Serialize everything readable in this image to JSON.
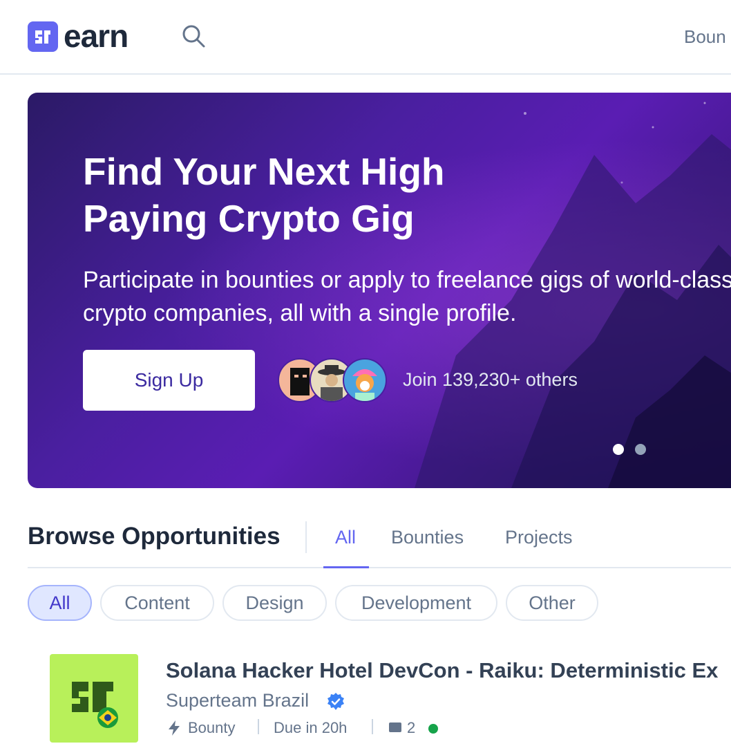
{
  "header": {
    "logo_text": "earn",
    "nav_link": "Boun"
  },
  "hero": {
    "title": "Find Your Next High Paying Crypto Gig",
    "subtitle": "Participate in bounties or apply to freelance gigs of world-class crypto companies, all with a single profile.",
    "signup_label": "Sign Up",
    "join_text": "Join 139,230+ others",
    "carousel_dots": 2,
    "carousel_active_index": 0
  },
  "browse": {
    "title": "Browse Opportunities",
    "tabs": [
      {
        "label": "All",
        "active": true
      },
      {
        "label": "Bounties",
        "active": false
      },
      {
        "label": "Projects",
        "active": false
      }
    ],
    "chips": [
      {
        "label": "All",
        "active": true
      },
      {
        "label": "Content",
        "active": false
      },
      {
        "label": "Design",
        "active": false
      },
      {
        "label": "Development",
        "active": false
      },
      {
        "label": "Other",
        "active": false
      }
    ]
  },
  "listing": {
    "title": "Solana Hacker Hotel DevCon - Raiku: Deterministic Ex",
    "sponsor": "Superteam Brazil",
    "type": "Bounty",
    "due": "Due in 20h",
    "comments": "2"
  },
  "colors": {
    "accent": "#6366f1",
    "hero_bg": "#4a1fa0",
    "listing_logo_bg": "#b8f05a",
    "status_green": "#16a34a"
  }
}
